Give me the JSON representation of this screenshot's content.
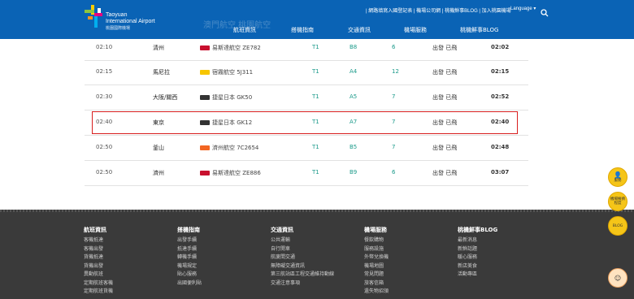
{
  "header": {
    "logo_text": "Taoyuan",
    "logo_text2": "International Airport",
    "logo_sub": "桃園國際機場",
    "shadow_text": "澳門航空 桃園航空",
    "top_links": [
      "網路填寫入國登記表",
      "機場公司網",
      "桃機鮮事BLOG",
      "加入桃園機場"
    ],
    "top_links_sep": " | ",
    "language": "Language",
    "nav": [
      "航班資訊",
      "搭機指南",
      "交通資訊",
      "機場服務",
      "桃機鮮事BLOG"
    ]
  },
  "flights": [
    {
      "sched": "02:10",
      "dest": "清州",
      "airline": "易斯達航空 ZE782",
      "logo_color": "#c8102e",
      "terminal": "T1",
      "gate": "B8",
      "counter": "6",
      "status": "出發 已飛",
      "actual": "02:02"
    },
    {
      "sched": "02:15",
      "dest": "馬尼拉",
      "airline": "宿霧航空 5J311",
      "logo_color": "#f7c600",
      "terminal": "T1",
      "gate": "A4",
      "counter": "12",
      "status": "出發 已飛",
      "actual": "02:15"
    },
    {
      "sched": "02:30",
      "dest": "大阪/關西",
      "airline": "捷星日本 GK50",
      "logo_color": "#333333",
      "terminal": "T1",
      "gate": "A5",
      "counter": "7",
      "status": "出發 已飛",
      "actual": "02:52"
    },
    {
      "sched": "02:40",
      "dest": "東京",
      "airline": "捷星日本 GK12",
      "logo_color": "#333333",
      "terminal": "T1",
      "gate": "A7",
      "counter": "7",
      "status": "出發 已飛",
      "actual": "02:40"
    },
    {
      "sched": "02:50",
      "dest": "釜山",
      "airline": "濟州航空 7C2654",
      "logo_color": "#f26522",
      "terminal": "T1",
      "gate": "B5",
      "counter": "7",
      "status": "出發 已飛",
      "actual": "02:48"
    },
    {
      "sched": "02:50",
      "dest": "濟州",
      "airline": "易斯達航空 ZE886",
      "logo_color": "#c8102e",
      "terminal": "T1",
      "gate": "B9",
      "counter": "6",
      "status": "出發 已飛",
      "actual": "03:07"
    }
  ],
  "footer": {
    "columns": [
      {
        "title": "航班資訊",
        "links": [
          "客機抵達",
          "客機出發",
          "貨機抵達",
          "貨機出發",
          "異動航班",
          "定期航班客機",
          "定期航班貨機"
        ]
      },
      {
        "title": "搭機指南",
        "links": [
          "出發手續",
          "抵達手續",
          "轉機手續",
          "機場規定",
          "貼心服務",
          "出國便利貼"
        ]
      },
      {
        "title": "交通資訊",
        "links": [
          "公共運輸",
          "自行開車",
          "航廈間交通",
          "無障礙交通資訊",
          "第三航站區工程交通維持動線",
          "交通注意事項"
        ]
      },
      {
        "title": "機場服務",
        "links": [
          "餐飲購物",
          "服務設施",
          "外幣兌換機",
          "機場地圖",
          "常見問題",
          "旅客信箱",
          "遺失物招領"
        ]
      },
      {
        "title": "桃機鮮事BLOG",
        "links": [
          "最新消息",
          "新鮮話題",
          "暖心服務",
          "新店美食",
          "活動專區"
        ]
      }
    ]
  },
  "float": {
    "service": "服務",
    "congestion_line1": "機場擁擠",
    "congestion_line2": "程度",
    "blog": "BLOG"
  }
}
